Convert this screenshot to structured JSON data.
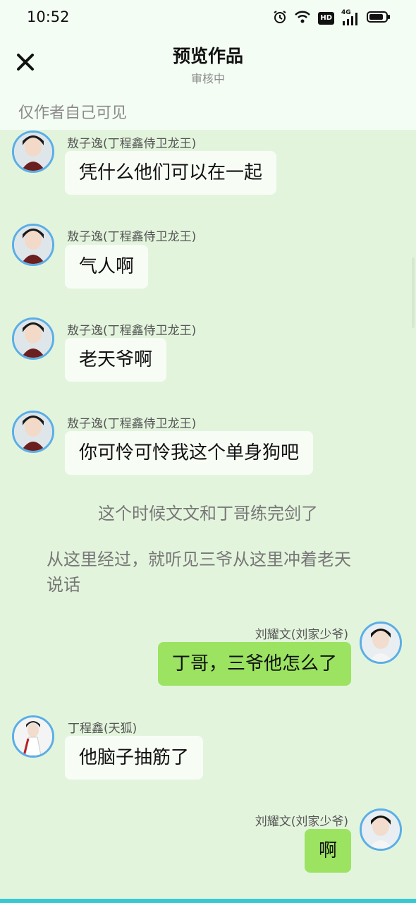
{
  "status_bar": {
    "time": "10:52",
    "icons": [
      "alarm-icon",
      "wifi-icon",
      "hd-icon",
      "signal-4g-icon",
      "battery-icon"
    ],
    "signal_label": "4G",
    "hd_label": "HD"
  },
  "header": {
    "title": "预览作品",
    "subtitle": "审核中",
    "visibility": "仅作者自己可见"
  },
  "colors": {
    "left_bubble": "#f7fcf5",
    "right_bubble": "#9be361",
    "chat_bg": "#e3f4dd",
    "avatar_ring": "#5aaee6"
  },
  "messages": [
    {
      "side": "left",
      "name": "敖子逸(丁程鑫侍卫龙王)",
      "text": "凭什么他们可以在一起"
    },
    {
      "side": "left",
      "name": "敖子逸(丁程鑫侍卫龙王)",
      "text": "气人啊"
    },
    {
      "side": "left",
      "name": "敖子逸(丁程鑫侍卫龙王)",
      "text": "老天爷啊"
    },
    {
      "side": "left",
      "name": "敖子逸(丁程鑫侍卫龙王)",
      "text": "你可怜可怜我这个单身狗吧"
    },
    {
      "side": "narration",
      "text": "这个时候文文和丁哥练完剑了"
    },
    {
      "side": "narration",
      "text": "从这里经过，就听见三爷从这里冲着老天说话",
      "line1": "从这里经过，就听见三爷从这里冲着老天",
      "line2": "说话"
    },
    {
      "side": "right",
      "name": "刘耀文(刘家少爷)",
      "text": "丁哥，三爷他怎么了"
    },
    {
      "side": "left",
      "name": "丁程鑫(天狐)",
      "text": "他脑子抽筋了"
    },
    {
      "side": "right",
      "name": "刘耀文(刘家少爷)",
      "text": "啊"
    }
  ]
}
